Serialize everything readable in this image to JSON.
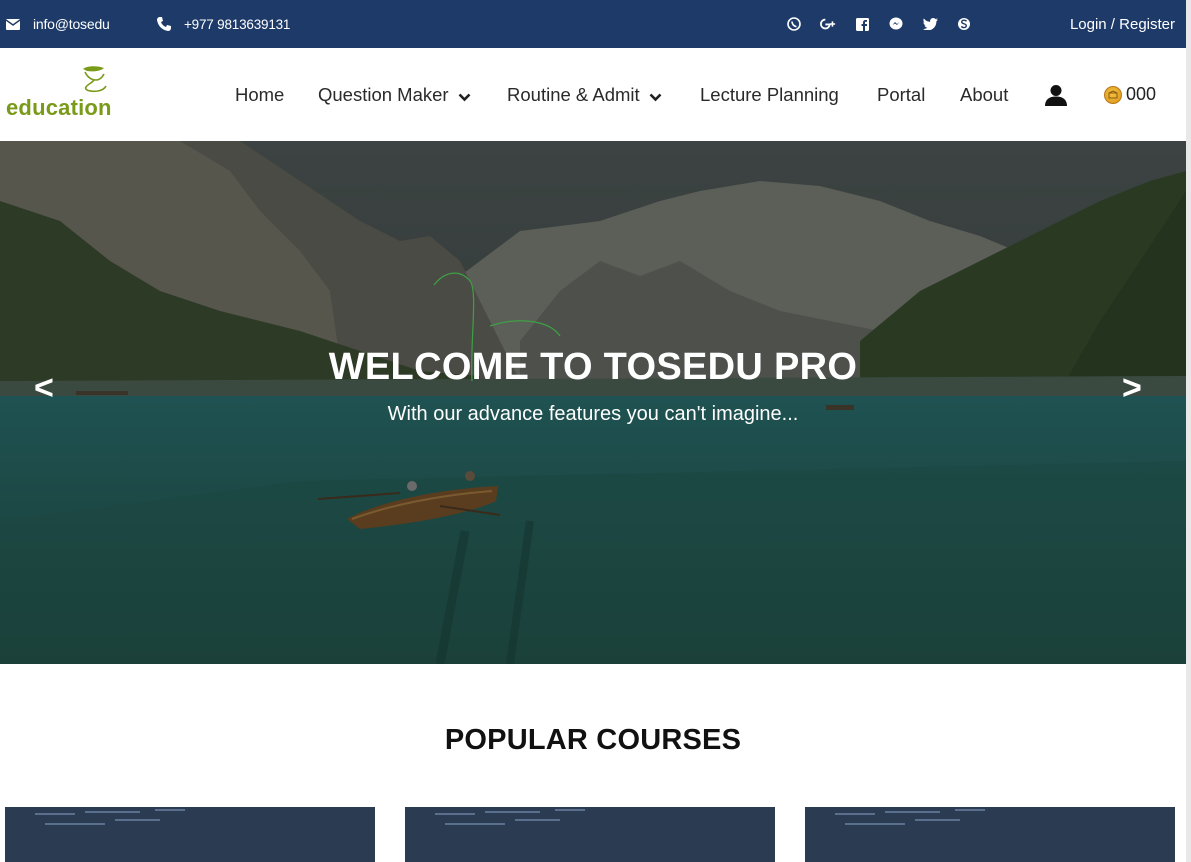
{
  "topbar": {
    "email": "info@tosedu",
    "phone": "+977 9813639131",
    "social_icons": [
      "viber-icon",
      "google-plus-icon",
      "facebook-icon",
      "messenger-icon",
      "twitter-icon",
      "skype-icon"
    ],
    "login": "Login / Register",
    "background_color": "#1d3a68"
  },
  "navbar": {
    "logo_text": "education",
    "items": [
      {
        "label": "Home",
        "has_dropdown": false
      },
      {
        "label": "Question Maker",
        "has_dropdown": true
      },
      {
        "label": "Routine & Admit",
        "has_dropdown": true
      },
      {
        "label": "Lecture Planning",
        "has_dropdown": false
      },
      {
        "label": "Portal",
        "has_dropdown": false
      },
      {
        "label": "About",
        "has_dropdown": false
      }
    ],
    "user_icon": "user-icon",
    "coins": "000",
    "logo_color": "#7a9a1a"
  },
  "hero": {
    "title": "WELCOME TO TOSEDU PRO",
    "subtitle": "With our advance features you can't imagine...",
    "prev": "<",
    "next": ">"
  },
  "courses": {
    "title": "POPULAR COURSES"
  }
}
